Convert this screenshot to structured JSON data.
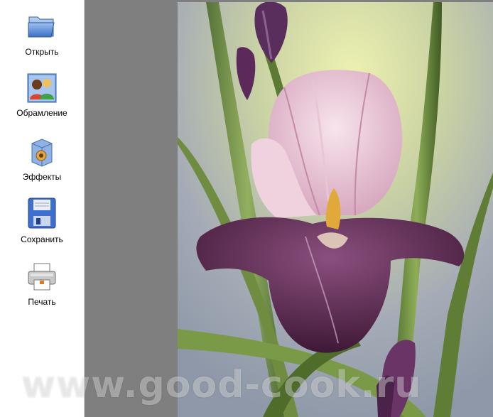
{
  "toolbar": {
    "open_label": "Открыть",
    "frame_label": "Обрамление",
    "effects_label": "Эффекты",
    "save_label": "Сохранить",
    "print_label": "Печать"
  },
  "icons": {
    "open": "folder-icon",
    "frame": "people-icon",
    "effects": "effects-box-icon",
    "save": "floppy-disk-icon",
    "print": "printer-icon"
  },
  "watermark": "www.good-cook.ru",
  "colors": {
    "sidebar_bg": "#ffffff",
    "workspace_bg": "#7f7f7f"
  }
}
